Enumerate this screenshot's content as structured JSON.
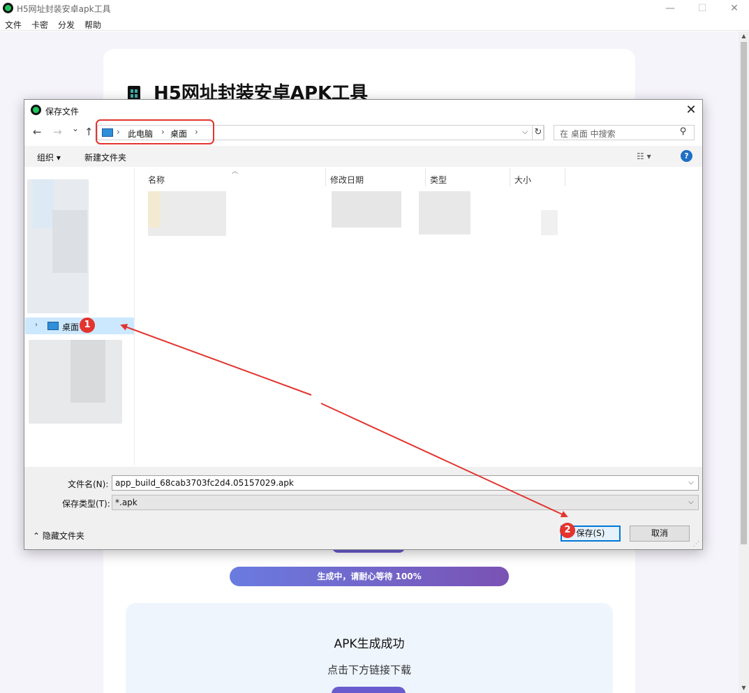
{
  "app": {
    "title": "H5网址封装安卓apk工具",
    "minimize_glyph": "—",
    "maximize_glyph": "☐",
    "close_glyph": "✕",
    "menu": [
      "文件",
      "卡密",
      "分发",
      "帮助"
    ]
  },
  "page": {
    "heading": "H5网址封装安卓APK工具",
    "progress_text": "生成中，请耐心等待 100%",
    "success_title": "APK生成成功",
    "success_subtitle": "点击下方链接下载"
  },
  "dialog": {
    "title": "保存文件",
    "close_glyph": "✕",
    "nav": {
      "back": "←",
      "forward": "→",
      "recent": "⌄",
      "up": "↑",
      "refresh": "↻"
    },
    "breadcrumb": [
      "此电脑",
      "桌面"
    ],
    "breadcrumb_sep": "›",
    "search_placeholder": "在 桌面 中搜索",
    "toolbar": {
      "organize": "组织 ▾",
      "new_folder": "新建文件夹",
      "view": "☷ ▾",
      "help": "?"
    },
    "columns": {
      "name": "名称",
      "modified": "修改日期",
      "type": "类型",
      "size": "大小"
    },
    "tree_selected": "桌面",
    "filename_label": "文件名(N):",
    "filename_value": "app_build_68cab3703fc2d4.05157029.apk",
    "filetype_label": "保存类型(T):",
    "filetype_value": "*.apk",
    "hide_folders": "隐藏文件夹",
    "save_label": "保存(S)",
    "cancel_label": "取消"
  },
  "annotations": {
    "badge1": "1",
    "badge2": "2",
    "color": "#e3342f"
  }
}
